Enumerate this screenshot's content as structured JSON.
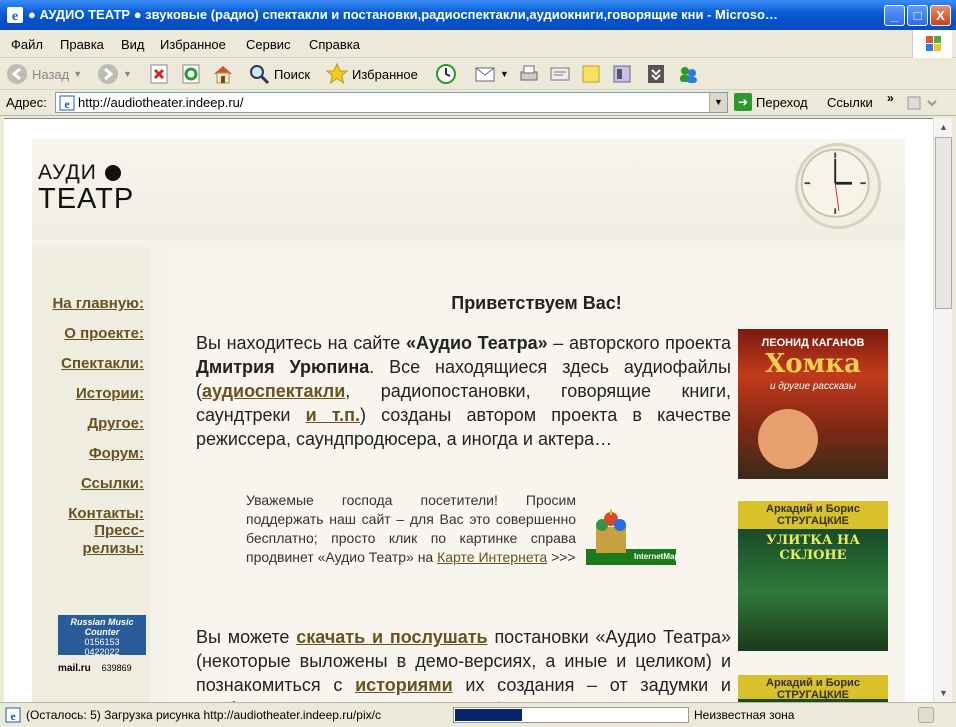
{
  "window": {
    "title": "● АУДИО ТЕАТР ● звуковые (радио) спектакли и постановки,радиоспектакли,аудиокниги,говорящие кни - Microso…",
    "minimize": "_",
    "maximize": "□",
    "close": "X"
  },
  "menu": [
    "Файл",
    "Правка",
    "Вид",
    "Избранное",
    "Сервис",
    "Справка"
  ],
  "toolbar": {
    "back": "Назад",
    "search": "Поиск",
    "favorites": "Избранное"
  },
  "address": {
    "label": "Адрес:",
    "url": "http://audiotheater.indeep.ru/",
    "go": "Переход",
    "links": "Ссылки",
    "more": "»"
  },
  "status": {
    "text": "(Осталось: 5) Загрузка рисунка http://audiotheater.indeep.ru/pix/c",
    "progress": 0.29,
    "zone": "Неизвестная зона"
  },
  "site": {
    "logo_top": "АУДИ",
    "logo_bottom": "ТЕАТР",
    "nav": [
      "На главную:",
      "О проекте:",
      "Спектакли:",
      "Истории:",
      "Другое:",
      "Форум:",
      "Ссылки:",
      "Контакты:",
      "Пресс-",
      "релизы:"
    ],
    "counter1": {
      "title": "Russian Music Counter",
      "line1": "0156153",
      "line2": "0422022"
    },
    "counter2": {
      "label": "mail.ru",
      "value": "639869"
    },
    "heading": "Приветствуем Вас!",
    "intro": {
      "p1": "Вы находитесь на сайте ",
      "b1": "«Аудио Театра»",
      "p2": " – авторского проекта ",
      "b2": "Дмитрия Урюпина",
      "p3": ". Все находящиеся здесь аудиофайлы (",
      "l1": "аудиоспектакли",
      "p4": ", радиопостановки, говорящие книги, саундтреки ",
      "l2": "и т.п.",
      "p5": ") созданы автором проекта в качестве режиссера, саундпродюсера, а иногда и актера…"
    },
    "notice": {
      "text": "Уважемые господа посетители! Просим поддержать наш сайт – для Вас это совершенно бесплатно; просто клик по картинке справа продвинет «Аудио Театр» на ",
      "link": "Карте Интернета",
      "tail": " >>>"
    },
    "map_label": "InternetMap.info",
    "second": {
      "p1": "Вы можете ",
      "l1": "скачать и послушать",
      "p2": " постановки «Аудио Театра» (некоторые выложены в демо-версиях, а иные и целиком) и познакомиться с ",
      "l2": "историями",
      "p3": " их создания – от задумки и подбора участников до шумового оформления"
    },
    "books": [
      {
        "author": "ЛЕОНИД КАГАНОВ",
        "title": "Хомка",
        "subtitle": "и другие рассказы"
      },
      {
        "author": "Аркадий и Борис СТРУГАЦКИЕ",
        "title": "УЛИТКА НА СКЛОНЕ"
      },
      {
        "author": "Аркадий и Борис СТРУГАЦКИЕ"
      }
    ]
  }
}
